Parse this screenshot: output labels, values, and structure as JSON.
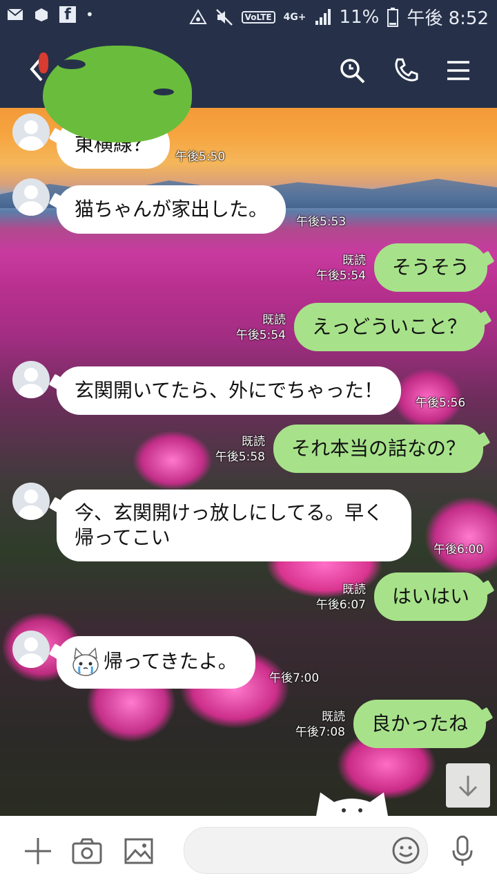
{
  "status_bar": {
    "network": "4G+",
    "volte": "VoLTE",
    "battery": "11%",
    "time": "午後 8:52"
  },
  "header": {
    "back_icon": "chevron-left-icon",
    "search_icon": "search-icon",
    "call_icon": "phone-icon",
    "menu_icon": "hamburger-menu-icon"
  },
  "messages": [
    {
      "side": "in",
      "text": "東横線？",
      "time": "午後5:50"
    },
    {
      "side": "in",
      "text": "猫ちゃんが家出した。",
      "time": "午後5:53"
    },
    {
      "side": "out",
      "text": "そうそう",
      "read": "既読",
      "time": "午後5:54"
    },
    {
      "side": "out",
      "text": "えっどういこと？",
      "read": "既読",
      "time": "午後5:54"
    },
    {
      "side": "in",
      "text": "玄関開いてたら、外にでちゃった！",
      "time": "午後5:56"
    },
    {
      "side": "out",
      "text": "それ本当の話なの？",
      "read": "既読",
      "time": "午後5:58"
    },
    {
      "side": "in",
      "text": "今、玄関開けっ放しにしてる。早く帰ってこい",
      "time": "午後6:00"
    },
    {
      "side": "out",
      "text": "はいはい",
      "read": "既読",
      "time": "午後6:07"
    },
    {
      "side": "in",
      "text": "帰ってきたよ。",
      "time": "午後7:00",
      "emoji": "crying-cat-emoji"
    },
    {
      "side": "out",
      "text": "良かったね",
      "read": "既読",
      "time": "午後7:08"
    }
  ],
  "input_bar": {
    "plus_icon": "plus-icon",
    "camera_icon": "camera-icon",
    "image_icon": "image-icon",
    "emoji_icon": "smiley-icon",
    "mic_icon": "microphone-icon"
  },
  "colors": {
    "header_bg": "#263149",
    "bubble_in": "#ffffff",
    "bubble_out": "#a7e28a",
    "title_redaction": "#6abd3c"
  }
}
